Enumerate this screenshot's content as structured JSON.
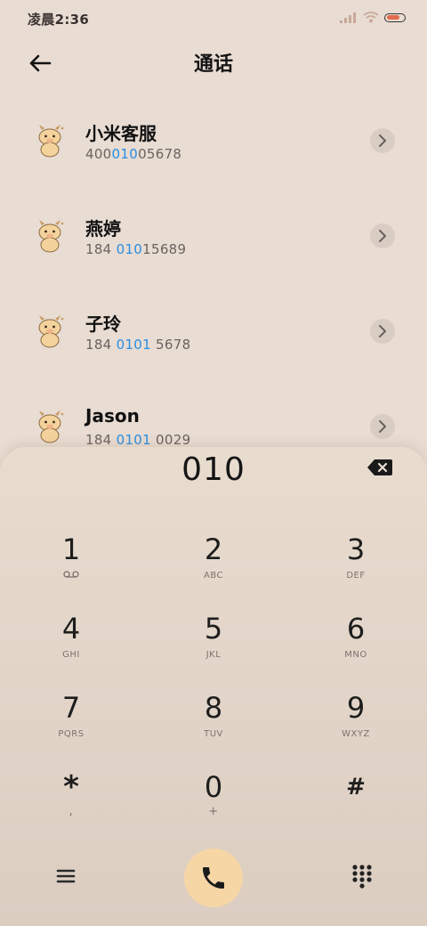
{
  "status_bar": {
    "time": "凌晨2:36"
  },
  "header": {
    "title": "通话"
  },
  "contacts": [
    {
      "name": "小米客服",
      "number_before": "400",
      "number_match": "010",
      "number_after": "05678"
    },
    {
      "name": "燕婷",
      "number_before": "184 ",
      "number_match": "010",
      "number_after": "15689"
    },
    {
      "name": "子玲",
      "number_before": "184 ",
      "number_match": "0101",
      "number_after": " 5678"
    },
    {
      "name": "Jason",
      "number_before": "184 ",
      "number_match": "0101",
      "number_after": " 0029"
    }
  ],
  "dialpad": {
    "entered": "010",
    "keys": [
      {
        "digit": "1",
        "letters": ""
      },
      {
        "digit": "2",
        "letters": "ABC"
      },
      {
        "digit": "3",
        "letters": "DEF"
      },
      {
        "digit": "4",
        "letters": "GHI"
      },
      {
        "digit": "5",
        "letters": "JKL"
      },
      {
        "digit": "6",
        "letters": "MNO"
      },
      {
        "digit": "7",
        "letters": "PQRS"
      },
      {
        "digit": "8",
        "letters": "TUV"
      },
      {
        "digit": "9",
        "letters": "WXYZ"
      },
      {
        "digit": "*",
        "letters": ","
      },
      {
        "digit": "0",
        "letters": "+"
      },
      {
        "digit": "#",
        "letters": ""
      }
    ]
  },
  "icons": {
    "back": "arrow-left-icon",
    "chevron": "chevron-right-icon",
    "backspace": "backspace-icon",
    "voicemail": "voicemail-icon",
    "menu": "menu-icon",
    "call": "phone-icon",
    "keypad": "dialpad-icon"
  },
  "colors": {
    "background": "#e8dcd3",
    "highlight": "#2a8ee0",
    "call_button": "#f7d6a6"
  }
}
